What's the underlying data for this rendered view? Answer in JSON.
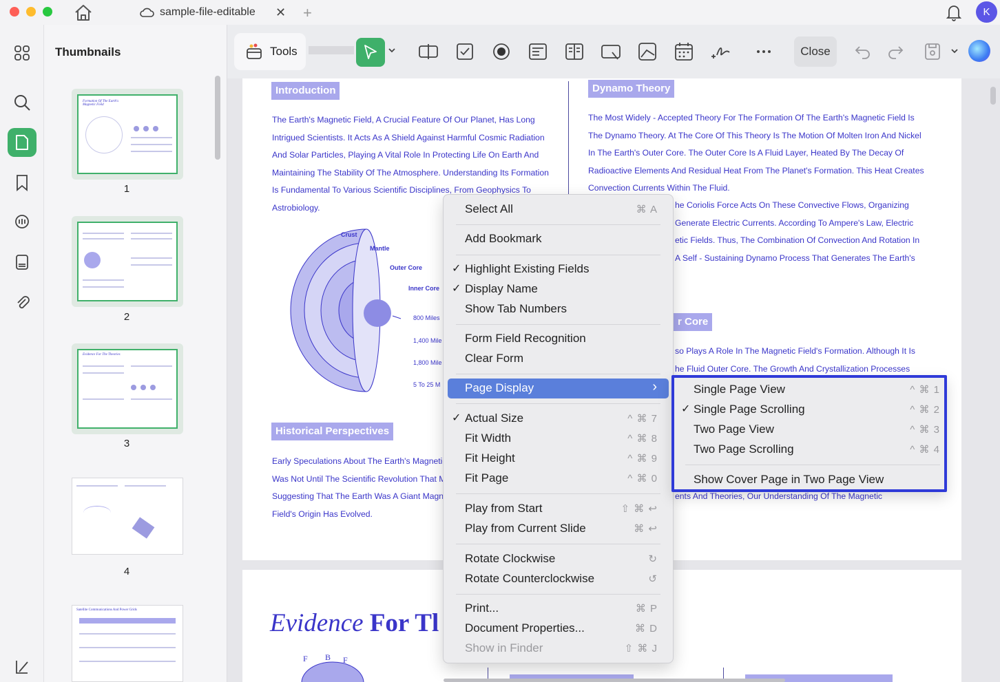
{
  "window": {
    "tab_title": "sample-file-editable",
    "tab_close": "✕",
    "tab_add": "+",
    "avatar_initial": "K"
  },
  "sidebar": {
    "title": "Thumbnails",
    "pages": [
      "1",
      "2",
      "3",
      "4"
    ],
    "thumb1_title": "Formation Of The Earth's Magnetic Field",
    "thumb3_title": "Evidence For The Theories",
    "thumb5_title": "Satellite Communications And Power Grids"
  },
  "toolbar": {
    "tools_label": "Tools",
    "close_label": "Close",
    "accent": "#3fb06a"
  },
  "document": {
    "intro_heading": "Introduction",
    "intro_lines": [
      "The Earth's Magnetic Field, A Crucial Feature Of Our Planet, Has Long",
      "Intrigued Scientists. It Acts As A Shield Against Harmful Cosmic Radiation",
      "And Solar Particles, Playing A Vital Role In Protecting Life On Earth And",
      "Maintaining The Stability Of The Atmosphere. Understanding Its Formation",
      "Is Fundamental To Various Scientific Disciplines, From Geophysics To",
      "Astrobiology."
    ],
    "dynamo_heading": "Dynamo Theory",
    "dynamo_lines": [
      "The Most Widely - Accepted Theory For The Formation Of The Earth's Magnetic Field Is",
      "The Dynamo Theory. At The Core Of This Theory Is The Motion Of Molten Iron And Nickel",
      "In The Earth's Outer Core. The Outer Core Is A Fluid Layer, Heated By The Decay Of",
      "Radioactive Elements And Residual Heat From The Planet's Formation. This Heat Creates",
      "Convection Currents Within The Fluid."
    ],
    "dynamo_partial": [
      "he Coriolis Force Acts On These Convective Flows, Organizing",
      "Generate Electric Currents. According To Ampere's Law, Electric",
      "etic Fields. Thus, The Combination Of Convection And Rotation In",
      "A Self - Sustaining Dynamo Process That Generates The Earth's"
    ],
    "core_heading_partial": "r Core",
    "core_partial": [
      "so Plays A Role In The Magnetic Field's Formation. Although It Is",
      "he Fluid Outer Core. The Growth And Crystallization Processes"
    ],
    "theories_partial": "ents And Theories, Our Understanding Of The Magnetic",
    "diagram_labels": {
      "crust": "Crust",
      "mantle": "Mantle",
      "outer_core": "Outer Core",
      "inner_core": "Inner Core",
      "d1": "800 Miles",
      "d2": "1,400 Mile",
      "d3": "1,800 Mile",
      "d4": "5 To 25 M"
    },
    "historical_heading": "Historical Perspectives",
    "historical_lines": [
      "Early Speculations About The Earth's Magnetic",
      "Was Not Until The Scientific Revolution That Mo",
      "Suggesting That The Earth Was A Giant Magne",
      "Field's Origin Has Evolved."
    ],
    "page2_title_italic": "Evidence",
    "page2_title_bold": "For Tl",
    "fig_labels": [
      "F",
      "B",
      "F"
    ]
  },
  "context_menu": {
    "items": [
      {
        "label": "Select All",
        "shortcut": "⌘ A",
        "checked": ""
      },
      {
        "label": "Add Bookmark",
        "shortcut": "",
        "checked": ""
      },
      {
        "label": "Highlight Existing Fields",
        "shortcut": "",
        "checked": "✓"
      },
      {
        "label": "Display Name",
        "shortcut": "",
        "checked": "✓"
      },
      {
        "label": "Show Tab Numbers",
        "shortcut": "",
        "checked": ""
      },
      {
        "label": "Form Field Recognition",
        "shortcut": "",
        "checked": ""
      },
      {
        "label": "Clear Form",
        "shortcut": "",
        "checked": ""
      },
      {
        "label": "Page Display",
        "shortcut": "›",
        "checked": ""
      },
      {
        "label": "Actual Size",
        "shortcut": "^ ⌘ 7",
        "checked": "✓"
      },
      {
        "label": "Fit Width",
        "shortcut": "^ ⌘ 8",
        "checked": ""
      },
      {
        "label": "Fit Height",
        "shortcut": "^ ⌘ 9",
        "checked": ""
      },
      {
        "label": "Fit Page",
        "shortcut": "^ ⌘ 0",
        "checked": ""
      },
      {
        "label": "Play from Start",
        "shortcut": "⇧ ⌘ ↩",
        "checked": ""
      },
      {
        "label": "Play from Current Slide",
        "shortcut": "⌘ ↩",
        "checked": ""
      },
      {
        "label": "Rotate Clockwise",
        "shortcut": "↻",
        "checked": ""
      },
      {
        "label": "Rotate Counterclockwise",
        "shortcut": "↺",
        "checked": ""
      },
      {
        "label": "Print...",
        "shortcut": "⌘ P",
        "checked": ""
      },
      {
        "label": "Document Properties...",
        "shortcut": "⌘ D",
        "checked": ""
      },
      {
        "label": "Show in Finder",
        "shortcut": "⇧ ⌘ J",
        "checked": ""
      }
    ],
    "highlight_color": "#5a7fdb"
  },
  "submenu": {
    "items": [
      {
        "label": "Single Page View",
        "shortcut": "^ ⌘ 1",
        "checked": ""
      },
      {
        "label": "Single Page Scrolling",
        "shortcut": "^ ⌘ 2",
        "checked": "✓"
      },
      {
        "label": "Two Page View",
        "shortcut": "^ ⌘ 3",
        "checked": ""
      },
      {
        "label": "Two Page Scrolling",
        "shortcut": "^ ⌘ 4",
        "checked": ""
      },
      {
        "label": "Show Cover Page in Two Page View",
        "shortcut": "",
        "checked": ""
      }
    ],
    "outline_color": "#2f3ad8"
  }
}
